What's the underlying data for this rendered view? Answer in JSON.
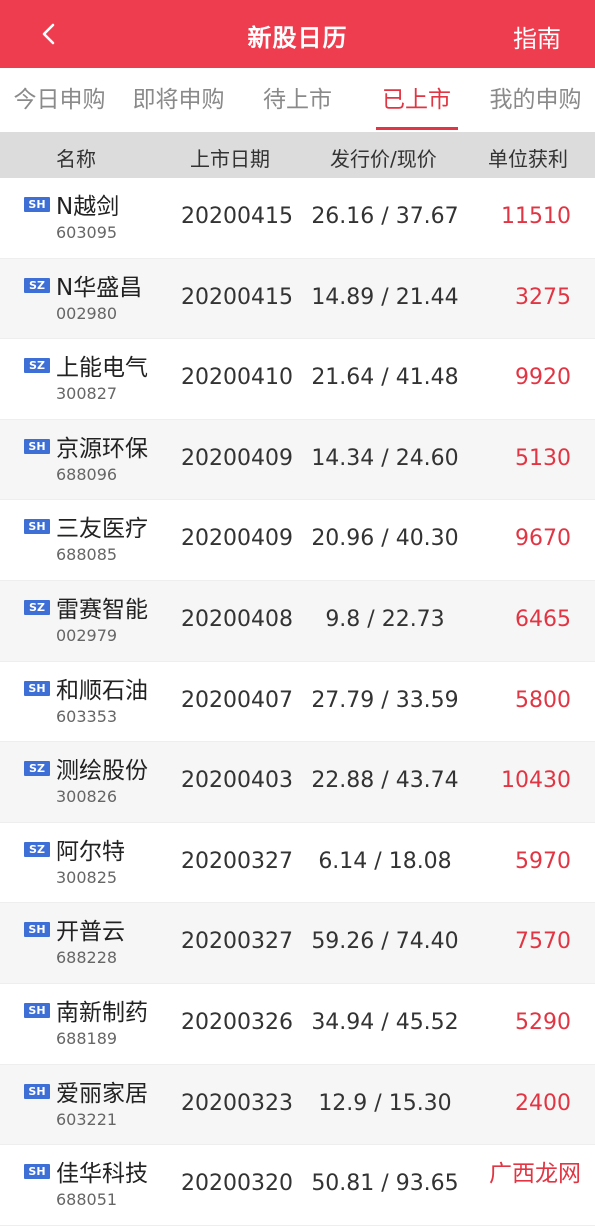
{
  "header": {
    "title": "新股日历",
    "guide_label": "指南"
  },
  "tabs": [
    {
      "label": "今日申购"
    },
    {
      "label": "即将申购"
    },
    {
      "label": "待上市"
    },
    {
      "label": "已上市",
      "active": true
    },
    {
      "label": "我的申购"
    }
  ],
  "table": {
    "headers": {
      "name": "名称",
      "date": "上市日期",
      "price": "发行价/现价",
      "profit": "单位获利"
    },
    "rows": [
      {
        "market": "SH",
        "name": "N越剑",
        "code": "603095",
        "date": "20200415",
        "price": "26.16 / 37.67",
        "profit": "11510"
      },
      {
        "market": "SZ",
        "name": "N华盛昌",
        "code": "002980",
        "date": "20200415",
        "price": "14.89 / 21.44",
        "profit": "3275"
      },
      {
        "market": "SZ",
        "name": "上能电气",
        "code": "300827",
        "date": "20200410",
        "price": "21.64 / 41.48",
        "profit": "9920"
      },
      {
        "market": "SH",
        "name": "京源环保",
        "code": "688096",
        "date": "20200409",
        "price": "14.34 / 24.60",
        "profit": "5130"
      },
      {
        "market": "SH",
        "name": "三友医疗",
        "code": "688085",
        "date": "20200409",
        "price": "20.96 / 40.30",
        "profit": "9670"
      },
      {
        "market": "SZ",
        "name": "雷赛智能",
        "code": "002979",
        "date": "20200408",
        "price": "9.8 / 22.73",
        "profit": "6465"
      },
      {
        "market": "SH",
        "name": "和顺石油",
        "code": "603353",
        "date": "20200407",
        "price": "27.79 / 33.59",
        "profit": "5800"
      },
      {
        "market": "SZ",
        "name": "测绘股份",
        "code": "300826",
        "date": "20200403",
        "price": "22.88 / 43.74",
        "profit": "10430"
      },
      {
        "market": "SZ",
        "name": "阿尔特",
        "code": "300825",
        "date": "20200327",
        "price": "6.14 / 18.08",
        "profit": "5970"
      },
      {
        "market": "SH",
        "name": "开普云",
        "code": "688228",
        "date": "20200327",
        "price": "59.26 / 74.40",
        "profit": "7570"
      },
      {
        "market": "SH",
        "name": "南新制药",
        "code": "688189",
        "date": "20200326",
        "price": "34.94 / 45.52",
        "profit": "5290"
      },
      {
        "market": "SH",
        "name": "爱丽家居",
        "code": "603221",
        "date": "20200323",
        "price": "12.9 / 15.30",
        "profit": "2400"
      },
      {
        "market": "SH",
        "name": "佳华科技",
        "code": "688051",
        "date": "20200320",
        "price": "50.81 / 93.65",
        "profit": ""
      }
    ]
  },
  "watermark": "广西龙网",
  "colors": {
    "brand": "#ee3d4f",
    "accent": "#e23543",
    "badge": "#3d6fd6"
  }
}
